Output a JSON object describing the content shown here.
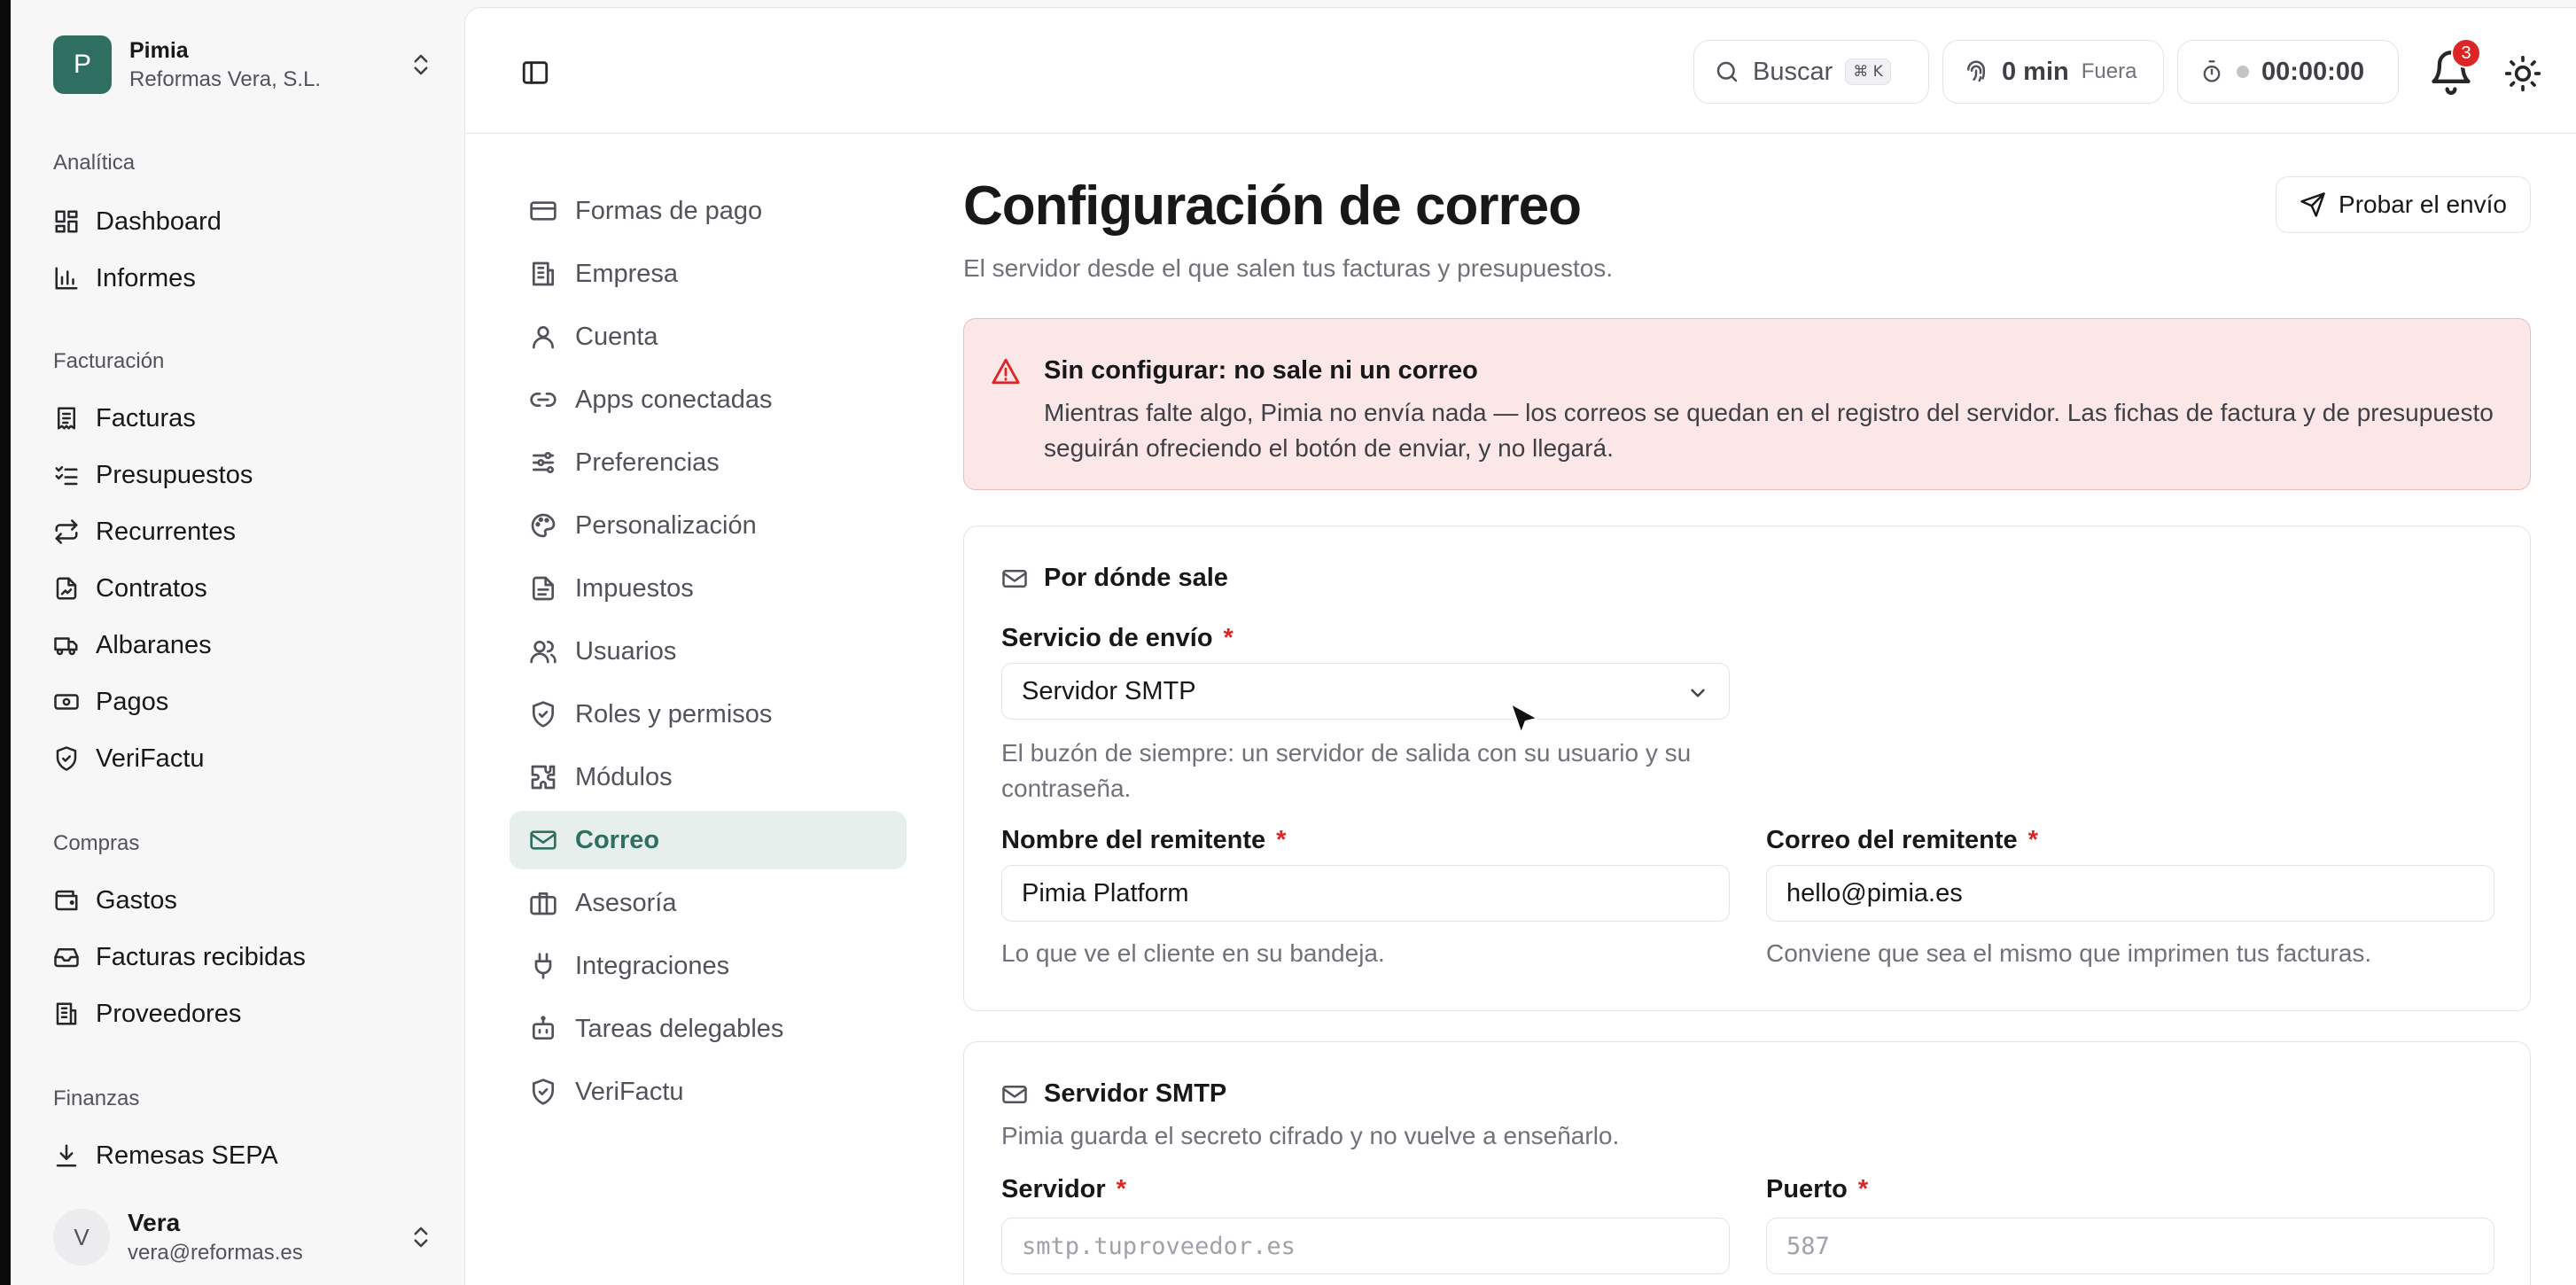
{
  "org": {
    "initial": "P",
    "name": "Pimia",
    "company": "Reformas Vera, S.L."
  },
  "sidebar": {
    "sections": [
      {
        "title": "Analítica",
        "items": [
          "Dashboard",
          "Informes"
        ]
      },
      {
        "title": "Facturación",
        "items": [
          "Facturas",
          "Presupuestos",
          "Recurrentes",
          "Contratos",
          "Albaranes",
          "Pagos",
          "VeriFactu"
        ]
      },
      {
        "title": "Compras",
        "items": [
          "Gastos",
          "Facturas recibidas",
          "Proveedores"
        ]
      },
      {
        "title": "Finanzas",
        "items": [
          "Remesas SEPA"
        ]
      }
    ]
  },
  "user": {
    "initial": "V",
    "name": "Vera",
    "email": "vera@reformas.es"
  },
  "topbar": {
    "search_label": "Buscar",
    "search_shortcut": "⌘ K",
    "time_value": "0 min",
    "time_status": "Fuera",
    "timer": "00:00:00",
    "notifications": "3"
  },
  "settings_nav": {
    "items": [
      "Formas de pago",
      "Empresa",
      "Cuenta",
      "Apps conectadas",
      "Preferencias",
      "Personalización",
      "Impuestos",
      "Usuarios",
      "Roles y permisos",
      "Módulos",
      "Correo",
      "Asesoría",
      "Integraciones",
      "Tareas delegables",
      "VeriFactu"
    ],
    "active": "Correo"
  },
  "page": {
    "title": "Configuración de correo",
    "subtitle": "El servidor desde el que salen tus facturas y presupuestos.",
    "test_button": "Probar el envío"
  },
  "alert": {
    "title": "Sin configurar: no sale ni un correo",
    "body": "Mientras falte algo, Pimia no envía nada — los correos se quedan en el registro del servidor. Las fichas de factura y de presupuesto seguirán ofreciendo el botón de enviar, y no llegará."
  },
  "card_delivery": {
    "title": "Por dónde sale",
    "service_label": "Servicio de envío",
    "service_value": "Servidor SMTP",
    "service_help": "El buzón de siempre: un servidor de salida con su usuario y su contraseña.",
    "sender_name_label": "Nombre del remitente",
    "sender_name_value": "Pimia Platform",
    "sender_name_help": "Lo que ve el cliente en su bandeja.",
    "sender_email_label": "Correo del remitente",
    "sender_email_value": "hello@pimia.es",
    "sender_email_help": "Conviene que sea el mismo que imprimen tus facturas."
  },
  "card_smtp": {
    "title": "Servidor SMTP",
    "subtitle": "Pimia guarda el secreto cifrado y no vuelve a enseñarlo.",
    "server_label": "Servidor",
    "server_placeholder": "smtp.tuproveedor.es",
    "port_label": "Puerto",
    "port_placeholder": "587"
  },
  "required_mark": "*"
}
